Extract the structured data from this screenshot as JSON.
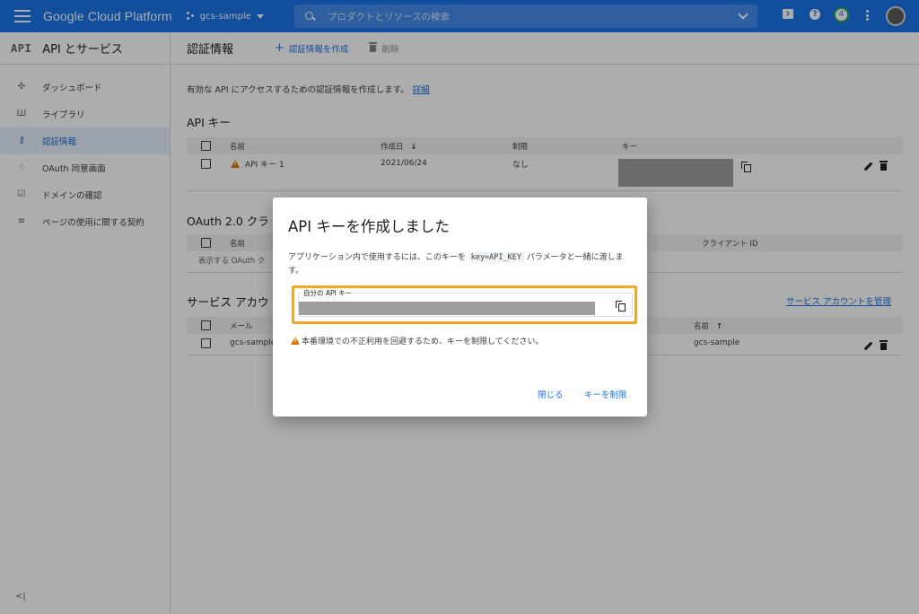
{
  "header": {
    "brand": "Google Cloud Platform",
    "project": "gcs-sample",
    "search_placeholder": "プロダクトとリソースの検索",
    "notification_count": "4",
    "help_glyph": "?",
    "icons": [
      "menu-icon",
      "project-dots-icon",
      "search-icon",
      "chevron-down-icon",
      "cloud-shell-icon",
      "help-icon",
      "notification-icon",
      "more-vert-icon",
      "avatar"
    ],
    "colors": {
      "bar": "#1a73e8",
      "badge_ring": "#34a853"
    }
  },
  "sidebar": {
    "logo": "API",
    "title": "API とサービス",
    "items": [
      {
        "label": "ダッシュボード",
        "icon": "dashboard-icon",
        "glyph": "✣"
      },
      {
        "label": "ライブラリ",
        "icon": "library-icon",
        "glyph": "Ш"
      },
      {
        "label": "認証情報",
        "icon": "key-icon",
        "glyph": "⚷",
        "active": true
      },
      {
        "label": "OAuth 同意画面",
        "icon": "consent-icon",
        "glyph": "⁘"
      },
      {
        "label": "ドメインの確認",
        "icon": "domain-check-icon",
        "glyph": "☑"
      },
      {
        "label": "ページの使用に関する契約",
        "icon": "settings-list-icon",
        "glyph": "≡"
      }
    ],
    "collapse": "<|"
  },
  "toolbar": {
    "title": "認証情報",
    "create_label": "認証情報を作成",
    "create_glyph": "+",
    "delete_label": "削除"
  },
  "main": {
    "description": "有効な API にアクセスするための認証情報を作成します。",
    "details_link": "詳細",
    "api_keys": {
      "title": "API キー",
      "headers": [
        "名前",
        "作成日",
        "制限",
        "キー"
      ],
      "sort_glyph": "↓",
      "rows": [
        {
          "name": "API キー 1",
          "created": "2021/06/24",
          "restriction": "なし"
        }
      ]
    },
    "oauth": {
      "title": "OAuth 2.0 クラ",
      "headers": [
        "名前",
        "クライアント ID"
      ],
      "empty": "表示する OAuth ク"
    },
    "service_accounts": {
      "title": "サービス アカウ",
      "manage_link": "サービス アカウントを管理",
      "headers": [
        "メール",
        "名前"
      ],
      "sort_glyph": "↑",
      "rows": [
        {
          "email": "gcs-sample",
          "name": "gcs-sample"
        }
      ]
    }
  },
  "dialog": {
    "title": "API キーを作成しました",
    "text_before": "アプリケーション内で使用するには、このキーを",
    "code": "key=API_KEY",
    "text_after": "パラメータと一緒に渡します。",
    "field_label": "自分の API キー",
    "warning": "本番環境での不正利用を回避するため、キーを制限してください。",
    "close_button": "閉じる",
    "restrict_button": "キーを制限",
    "highlight_color": "#f5a623",
    "warning_color": "#e37400"
  }
}
